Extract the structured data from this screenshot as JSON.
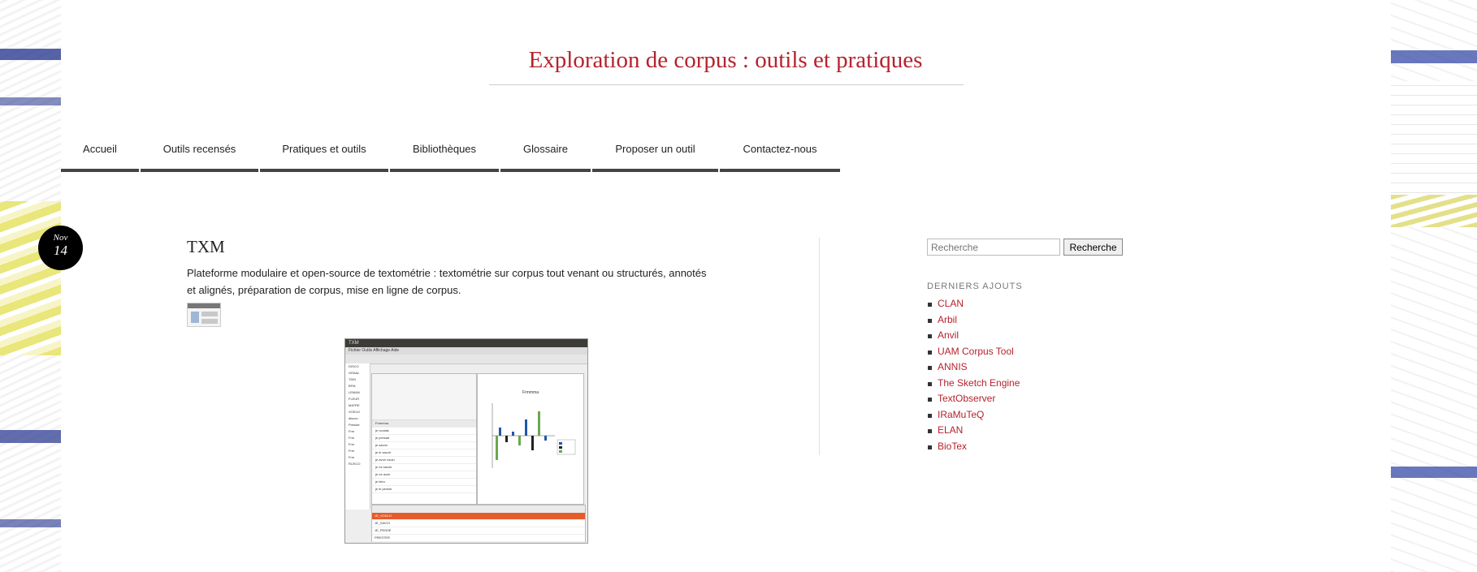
{
  "site": {
    "title": "Exploration de corpus : outils et pratiques"
  },
  "nav": {
    "items": [
      {
        "label": "Accueil"
      },
      {
        "label": "Outils recensés"
      },
      {
        "label": "Pratiques et outils"
      },
      {
        "label": "Bibliothèques"
      },
      {
        "label": "Glossaire"
      },
      {
        "label": "Proposer un outil"
      },
      {
        "label": "Contactez-nous"
      }
    ]
  },
  "post": {
    "date_month": "Nov",
    "date_day": "14",
    "title": "TXM",
    "excerpt": "Plateforme modulaire et open-source de textométrie : textométrie sur corpus tout venant ou structurés, annotés et alignés, préparation de corpus, mise en ligne de corpus.",
    "screenshot": {
      "window_title": "TXM",
      "menu": "Fichier   Outils   Affichage   Aide",
      "graph_title": "Frmmma",
      "table_rows": [
        "Frmmma",
        "je voulais",
        "je pensait",
        "je savoir",
        "je le savoir",
        "je avoir voulu",
        "je ne savoir",
        "je ne avoir",
        "je bien",
        "je le penser"
      ],
      "tree_items": [
        "DISCO",
        "GRAAL",
        "TDM",
        "BFM",
        "LEMAN",
        "FLEUR",
        "MATRE",
        "VOEUX",
        "discou",
        "Preside",
        "Frm",
        "Frm",
        "Frm",
        "Frm",
        "Frm",
        "RUSCO"
      ],
      "bottom_rows": [
        "JE_VOULO",
        "JE_SAVOI",
        "JE_PENSE",
        "PRESTER"
      ]
    }
  },
  "sidebar": {
    "search_placeholder": "Recherche",
    "search_button": "Recherche",
    "recent_title": "DERNIERS AJOUTS",
    "recent_items": [
      {
        "label": "CLAN"
      },
      {
        "label": "Arbil"
      },
      {
        "label": "Anvil"
      },
      {
        "label": "UAM Corpus Tool"
      },
      {
        "label": "ANNIS"
      },
      {
        "label": "The Sketch Engine"
      },
      {
        "label": "TextObserver"
      },
      {
        "label": "IRaMuTeQ"
      },
      {
        "label": "ELAN"
      },
      {
        "label": "BioTex"
      }
    ]
  },
  "colors": {
    "accent": "#b5222d",
    "nav_border": "#444444"
  }
}
